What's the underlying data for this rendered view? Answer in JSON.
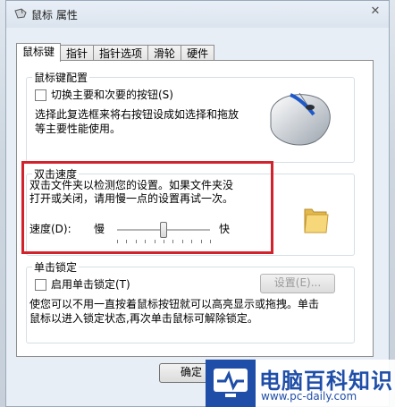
{
  "window": {
    "title": "鼠标 属性",
    "close_glyph": "✕"
  },
  "tabs": [
    "鼠标键",
    "指针",
    "指针选项",
    "滑轮",
    "硬件"
  ],
  "button_config": {
    "legend": "鼠标键配置",
    "checkbox_label": "切换主要和次要的按钮(S)",
    "description_line1": "选择此复选框来将右按钮设成如选择和拖放",
    "description_line2": "等主要性能使用。"
  },
  "double_click": {
    "legend": "双击速度",
    "description_line1": "双击文件夹以检测您的设置。如果文件夹没",
    "description_line2": "打开或关闭，请用慢一点的设置再试一次。",
    "speed_label": "速度(D):",
    "slow": "慢",
    "fast": "快",
    "speed_level": 0.5
  },
  "click_lock": {
    "legend": "单击锁定",
    "checkbox_label": "启用单击锁定(T)",
    "settings_button": "设置(E)...",
    "description_line1": "使您可以不用一直按着鼠标按钮就可以高亮显示或拖拽。单击",
    "description_line2": "鼠标以进入锁定状态,再次单击鼠标可解除锁定。"
  },
  "footer": {
    "ok_button": "确定"
  },
  "watermark": {
    "name": "电脑百科知识",
    "url": "www.pc-daily.com"
  }
}
